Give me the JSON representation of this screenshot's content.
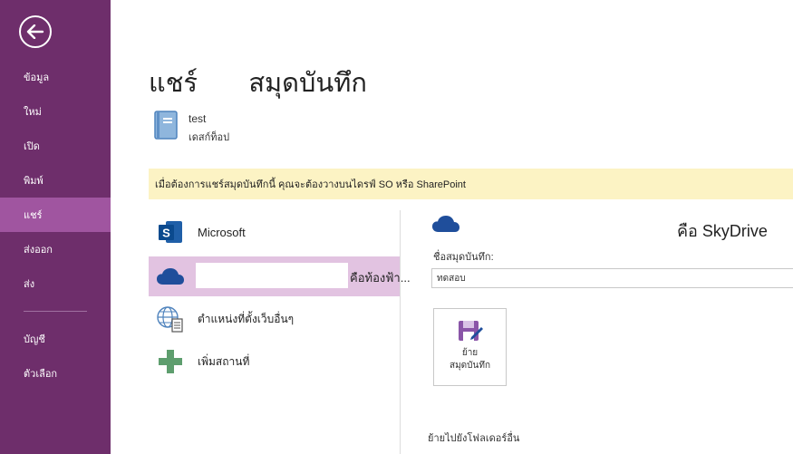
{
  "sidebar": {
    "items": [
      {
        "label": "ข้อมูล"
      },
      {
        "label": "ใหม่"
      },
      {
        "label": "เปิด"
      },
      {
        "label": "พิมพ์"
      },
      {
        "label": "แชร์"
      },
      {
        "label": "ส่งออก"
      },
      {
        "label": "ส่ง"
      },
      {
        "label": "บัญชี"
      },
      {
        "label": "ตัวเลือก"
      }
    ],
    "active": "แชร์",
    "color": "#6e2e6b",
    "active_color": "#a055a0"
  },
  "header": {
    "title": "แชร์       สมุดบันทึก"
  },
  "notebook": {
    "name": "test",
    "location": "เดสก์ท็อป",
    "icon": "notebook-icon"
  },
  "notice": {
    "text": "เมื่อต้องการแชร์สมุดบันทึกนี้ คุณจะต้องวางบนไดรฟ์ SO หรือ SharePoint",
    "color": "#fcf3c4"
  },
  "locations": [
    {
      "label": "Microsoft",
      "icon": "sharepoint-icon"
    },
    {
      "label": "คือท้องฟ้า...",
      "icon": "onedrive-cloud-icon",
      "selected": true
    },
    {
      "label": "ตำแหน่งที่ตั้งเว็บอื่นๆ",
      "icon": "web-location-icon"
    },
    {
      "label": "เพิ่มสถานที่",
      "icon": "add-place-icon"
    }
  ],
  "right_panel": {
    "service_title": "คือ SkyDrive",
    "field_label": "ชื่อสมุดบันทึก:",
    "name_value": "ทดสอบ",
    "move_button_line1": "ย้าย",
    "move_button_line2": "สมุดบันทึก",
    "move_folder_text": "ย้ายไปยังโฟลเดอร์อื่น"
  },
  "colors": {
    "accent_blue": "#1f4e9b",
    "selected_row": "#e2c3e1"
  }
}
